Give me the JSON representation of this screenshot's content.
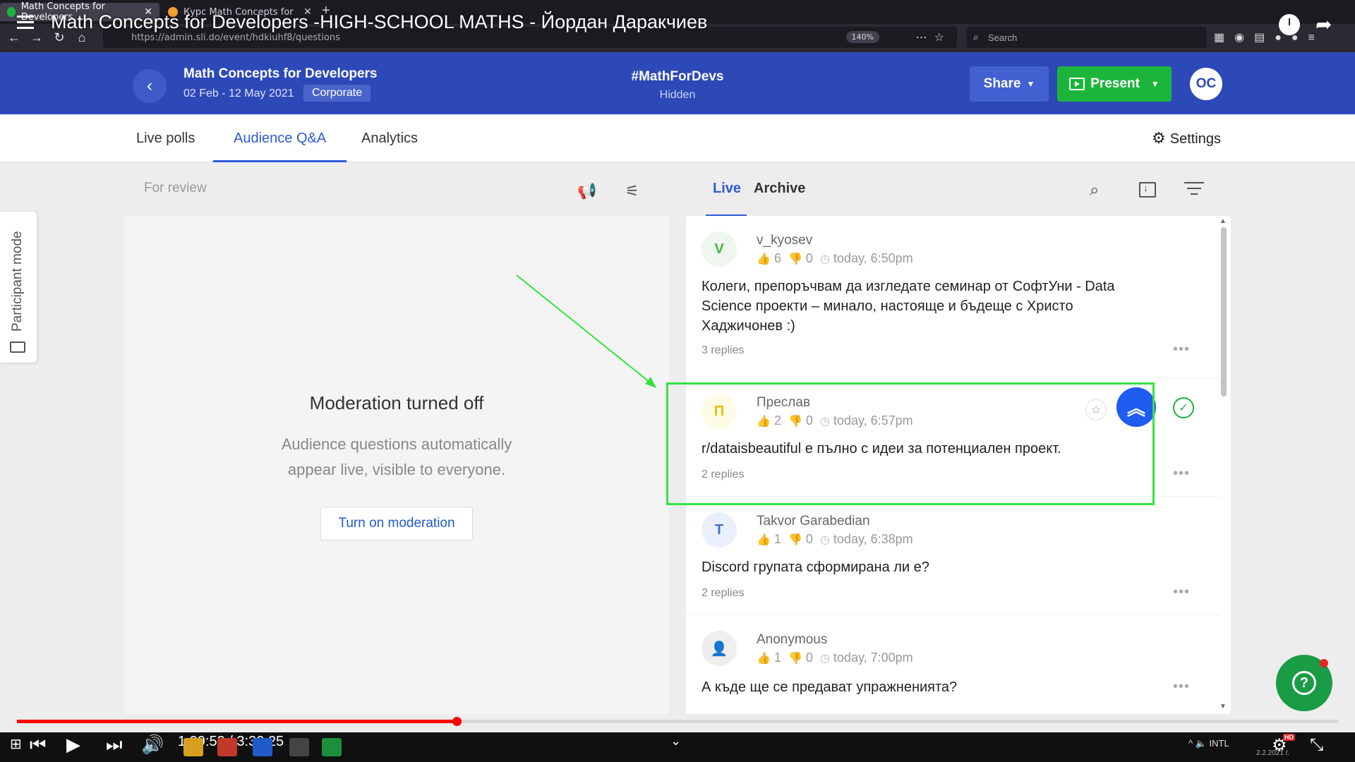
{
  "browser": {
    "tabs": [
      {
        "label": "Math Concepts for Developers",
        "active": true,
        "favicon_color": "#1cb53c"
      },
      {
        "label": "Курс Math Concepts for Devel",
        "active": false,
        "favicon_color": "#f0a030"
      }
    ],
    "url": "https://admin.sli.do/event/hdkiuhf8/questions",
    "zoom": "140%",
    "search_placeholder": "Search"
  },
  "video": {
    "title": "Math Concepts for Developers -HIGH-SCHOOL MATHS - Йордан Даракчиев",
    "time": "1:09:52 / 3:30:25",
    "progress": 0.3326,
    "tray_date": "2.2.2021 г.",
    "tray_lang": "INTL",
    "hd_label": "HD"
  },
  "header": {
    "event_name": "Math Concepts for Developers",
    "dates": "02 Feb - 12 May 2021",
    "badge": "Corporate",
    "code": "#MathForDevs",
    "visibility": "Hidden",
    "share_label": "Share",
    "present_label": "Present",
    "avatar_initials": "OC"
  },
  "tabs": {
    "live_polls": "Live polls",
    "audience_qa": "Audience Q&A",
    "analytics": "Analytics",
    "settings": "Settings"
  },
  "side": {
    "participant_mode": "Participant mode"
  },
  "review": {
    "label": "For review",
    "title": "Moderation turned off",
    "description": "Audience questions automatically appear live, visible to everyone.",
    "button": "Turn on moderation"
  },
  "questions_panel": {
    "live_label": "Live",
    "archive_label": "Archive",
    "items": [
      {
        "initial": "V",
        "avatar_color": "#4caf50",
        "avatar_bg": "#eef7ee",
        "author": "v_kyosev",
        "likes": "6",
        "dislikes": "0",
        "time": "today, 6:50pm",
        "text": "Колеги, препоръчвам да изгледате семинар от СофтУни - Data Science проекти – минало, настояще и бъдеще с Христо Хаджичонев :)",
        "replies": "3 replies"
      },
      {
        "initial": "П",
        "avatar_color": "#e0c000",
        "avatar_bg": "#fffbe5",
        "author": "Преслав",
        "likes": "2",
        "dislikes": "0",
        "time": "today, 6:57pm",
        "text": "r/dataisbeautiful е пълно с идеи за потенциален проект.",
        "replies": "2 replies"
      },
      {
        "initial": "T",
        "avatar_color": "#3a6fd8",
        "avatar_bg": "#eaf0fb",
        "author": "Takvor Garabedian",
        "likes": "1",
        "dislikes": "0",
        "time": "today, 6:38pm",
        "text": "Discord групата сформирана ли е?",
        "replies": "2 replies"
      },
      {
        "initial": "",
        "avatar_color": "#555555",
        "avatar_bg": "#eeeeee",
        "author": "Anonymous",
        "likes": "1",
        "dislikes": "0",
        "time": "today, 7:00pm",
        "text": "А къде ще се предават упражненията?",
        "replies": ""
      }
    ]
  },
  "colors": {
    "header_blue": "#2d49b8",
    "accent_blue": "#2d5bd8",
    "present_green": "#1cb53c",
    "highlight_box": "#34e33e",
    "progress_red": "#ff0000"
  }
}
